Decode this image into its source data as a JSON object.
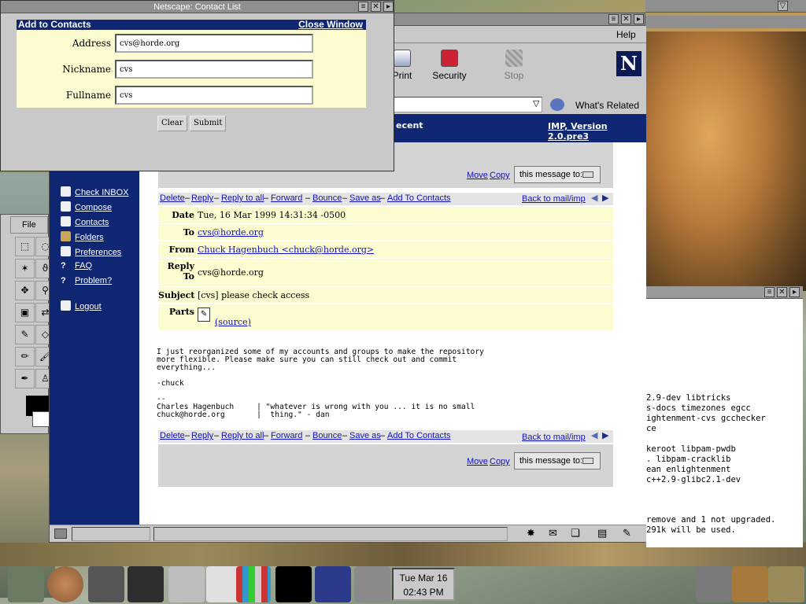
{
  "popup": {
    "title": "Netscape: Contact List",
    "heading": "Add to Contacts",
    "close_label": "Close Window",
    "fields": [
      {
        "label": "Address",
        "value": "cvs@horde.org"
      },
      {
        "label": "Nickname",
        "value": "cvs"
      },
      {
        "label": "Fullname",
        "value": "cvs"
      }
    ],
    "clear_label": "Clear",
    "submit_label": "Submit"
  },
  "browser": {
    "menu_help": "Help",
    "toolbar": [
      {
        "label": "Print",
        "icon": "print-icon"
      },
      {
        "label": "Security",
        "icon": "lock-icon"
      },
      {
        "label": "Stop",
        "icon": "stop-icon"
      }
    ],
    "whats_related": "What's Related",
    "logo_letter": "N"
  },
  "imp": {
    "banner_left": "ecent",
    "banner_right": "IMP, Version 2.0.pre3",
    "sidebar": [
      {
        "label": "Check INBOX",
        "icon": "home-icon"
      },
      {
        "label": "Compose",
        "icon": "compose-icon"
      },
      {
        "label": "Contacts",
        "icon": "contacts-icon"
      },
      {
        "label": "Folders",
        "icon": "folder-icon"
      },
      {
        "label": "Preferences",
        "icon": "preferences-icon"
      },
      {
        "label": "FAQ",
        "icon": "question-icon"
      },
      {
        "label": "Problem?",
        "icon": "question-icon"
      },
      {
        "label": "Logout",
        "icon": "logout-icon"
      }
    ],
    "move_label": "Move",
    "copy_label": "Copy",
    "move_target": "this message to:",
    "actions": [
      "Delete",
      "Reply",
      "Reply to all",
      "Forward",
      "Bounce",
      "Save as",
      "Add To Contacts"
    ],
    "back_link": "Back to mail/imp",
    "headers": {
      "date_k": "Date",
      "date_v": "Tue, 16 Mar 1999 14:31:34 -0500",
      "to_k": "To",
      "to_v": "cvs@horde.org",
      "from_k": "From",
      "from_v": "Chuck Hagenbuch <chuck@horde.org>",
      "reply_k1": "Reply",
      "reply_k2": "To",
      "reply_v": "cvs@horde.org",
      "subject_k": "Subject",
      "subject_v": "[cvs] please check access",
      "parts_k": "Parts",
      "parts_v": "(source)"
    },
    "body": "I just reorganized some of my accounts and groups to make the repository\nmore flexible. Please make sure you can still check out and commit\neverything...\n\n-chuck\n\n--\nCharles Hagenbuch     | \"whatever is wrong with you ... it is no small\nchuck@horde.org       |  thing.\" - dan"
  },
  "gimp": {
    "file_menu": "File"
  },
  "terminal": {
    "lines_top": [
      "2.9-dev libtricks",
      "s-docs timezones egcc",
      "ightenment-cvs gcchecker",
      "ce",
      "",
      "keroot libpam-pwdb",
      ". libpam-cracklib",
      "ean enlightenment",
      "c++2.9-glibc2.1-dev"
    ],
    "lines_bottom": [
      "remove and 1 not upgraded.",
      "291k will be used."
    ]
  },
  "taskbar": {
    "clock_day": "Tue Mar 16",
    "clock_time": "02:43 PM"
  }
}
